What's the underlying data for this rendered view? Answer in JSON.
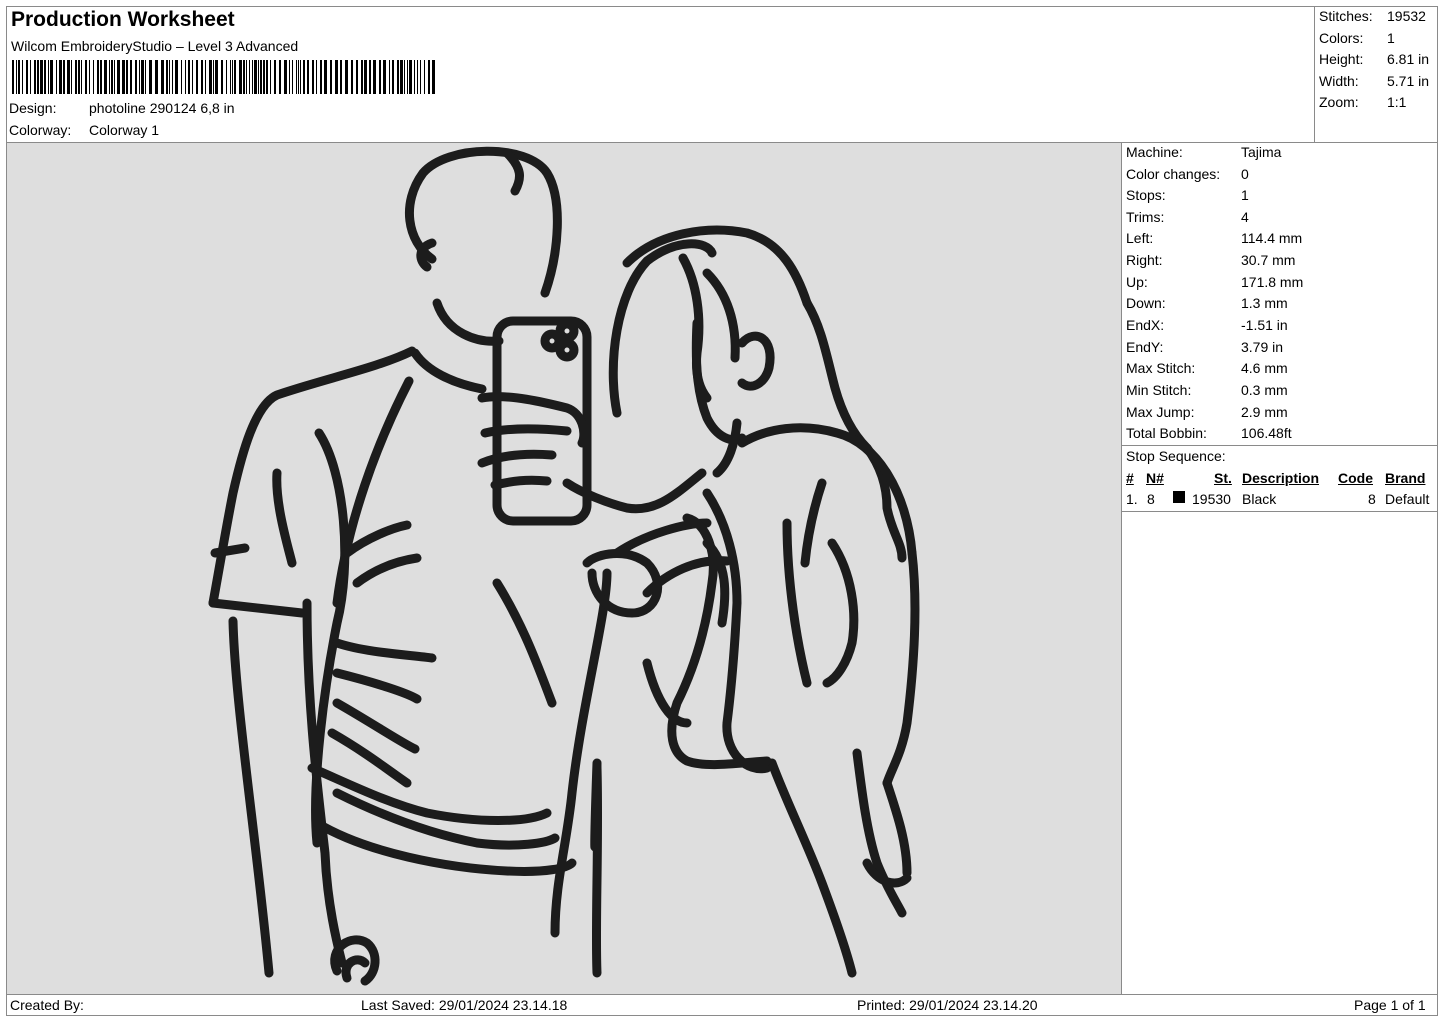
{
  "header": {
    "title": "Production Worksheet",
    "software": "Wilcom EmbroideryStudio – Level 3 Advanced",
    "design_label": "Design:",
    "design_value": "photoline 290124 6,8 in",
    "colorway_label": "Colorway:",
    "colorway_value": "Colorway 1"
  },
  "summary": [
    {
      "label": "Stitches:",
      "value": "19532"
    },
    {
      "label": "Colors:",
      "value": "1"
    },
    {
      "label": "Height:",
      "value": "6.81 in"
    },
    {
      "label": "Width:",
      "value": "5.71 in"
    },
    {
      "label": "Zoom:",
      "value": "1:1"
    }
  ],
  "machine_info": [
    {
      "label": "Machine:",
      "value": "Tajima"
    },
    {
      "label": "Color changes:",
      "value": "0"
    },
    {
      "label": "Stops:",
      "value": "1"
    },
    {
      "label": "Trims:",
      "value": "4"
    },
    {
      "label": "Left:",
      "value": "114.4 mm"
    },
    {
      "label": "Right:",
      "value": "30.7 mm"
    },
    {
      "label": "Up:",
      "value": "171.8 mm"
    },
    {
      "label": "Down:",
      "value": "1.3 mm"
    },
    {
      "label": "EndX:",
      "value": "-1.51 in"
    },
    {
      "label": "EndY:",
      "value": "3.79 in"
    },
    {
      "label": "Max Stitch:",
      "value": "4.6 mm"
    },
    {
      "label": "Min Stitch:",
      "value": "0.3 mm"
    },
    {
      "label": "Max Jump:",
      "value": "2.9 mm"
    },
    {
      "label": "Total Bobbin:",
      "value": "106.48ft"
    }
  ],
  "stop_sequence": {
    "title": "Stop Sequence:",
    "headers": {
      "index": "#",
      "needle": "N#",
      "stitches": "St.",
      "description": "Description",
      "code": "Code",
      "brand": "Brand"
    },
    "rows": [
      {
        "index": "1.",
        "needle": "8",
        "swatch_color": "#000000",
        "stitches": "19530",
        "description": "Black",
        "code": "8",
        "brand": "Default"
      }
    ]
  },
  "design_preview": {
    "background_color": "#dedede",
    "thread_color": "#1c1c1c"
  },
  "footer": {
    "created_by": "Created By:",
    "last_saved": "Last Saved: 29/01/2024 23.14.18",
    "printed": "Printed: 29/01/2024 23.14.20",
    "page": "Page 1 of 1"
  }
}
